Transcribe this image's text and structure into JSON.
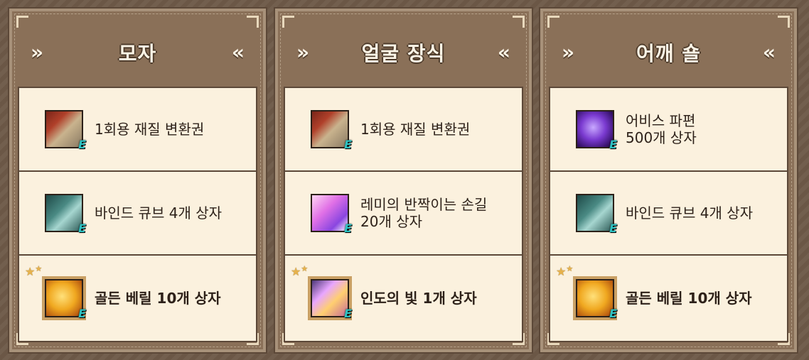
{
  "panels": [
    {
      "title": "모자",
      "items": [
        {
          "icon": "transmutation-ticket-icon",
          "lines": [
            "1회용 재질 변환권"
          ],
          "badge": "E"
        },
        {
          "icon": "bind-cube-icon",
          "lines": [
            "바인드 큐브 4개 상자"
          ],
          "badge": "E"
        },
        {
          "icon": "golden-beryl-icon",
          "lines": [
            "골든 베릴 10개 상자"
          ],
          "badge": "E",
          "rare": true
        }
      ]
    },
    {
      "title": "얼굴 장식",
      "items": [
        {
          "icon": "transmutation-ticket-icon",
          "lines": [
            "1회용 재질 변환권"
          ],
          "badge": "E"
        },
        {
          "icon": "remi-sparkle-icon",
          "lines": [
            "레미의 반짝이는 손길",
            "20개 상자"
          ],
          "badge": "E"
        },
        {
          "icon": "indo-light-icon",
          "lines": [
            "인도의 빛 1개 상자"
          ],
          "badge": "E",
          "rare": true
        }
      ]
    },
    {
      "title": "어깨 숄",
      "items": [
        {
          "icon": "abyss-fragment-icon",
          "lines": [
            "어비스 파편",
            "500개 상자"
          ],
          "badge": "E"
        },
        {
          "icon": "bind-cube-icon",
          "lines": [
            "바인드 큐브 4개 상자"
          ],
          "badge": "E"
        },
        {
          "icon": "golden-beryl-icon",
          "lines": [
            "골든 베릴 10개 상자"
          ],
          "badge": "E",
          "rare": true
        }
      ]
    }
  ],
  "chevrons": {
    "left": "»",
    "right": "«"
  },
  "stars": "★★"
}
